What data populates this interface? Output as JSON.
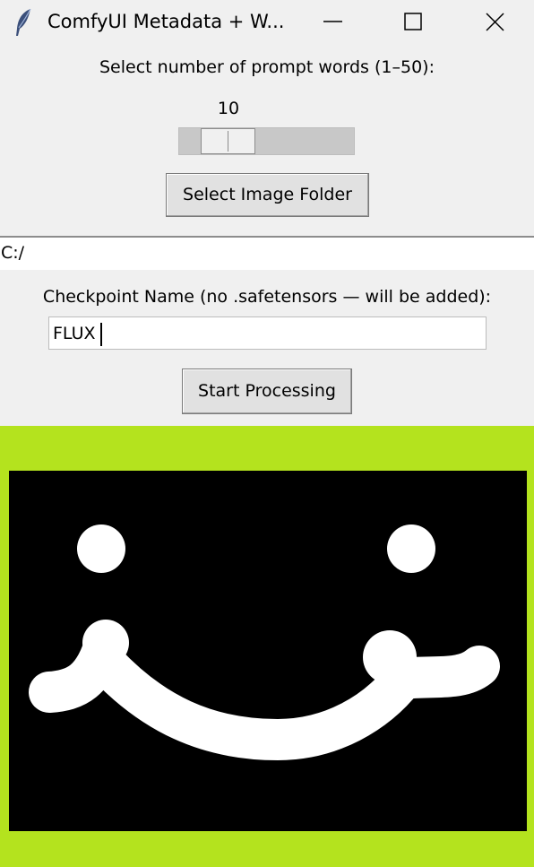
{
  "window": {
    "title": "ComfyUI Metadata + W...",
    "icon": "feather-icon",
    "controls": [
      "minimize-icon",
      "maximize-icon",
      "close-icon"
    ]
  },
  "prompt_words": {
    "label": "Select number of prompt words (1–50):",
    "value": "10",
    "min": 1,
    "max": 50
  },
  "folder": {
    "button_label": "Select Image Folder",
    "path": "C:/"
  },
  "checkpoint": {
    "label": "Checkpoint Name (no .safetensors — will be added):",
    "value": "FLUX"
  },
  "process": {
    "button_label": "Start Processing"
  },
  "preview": {
    "frame_color": "#b4e31e",
    "background": "#000000",
    "content": "white smiley face drawing"
  }
}
